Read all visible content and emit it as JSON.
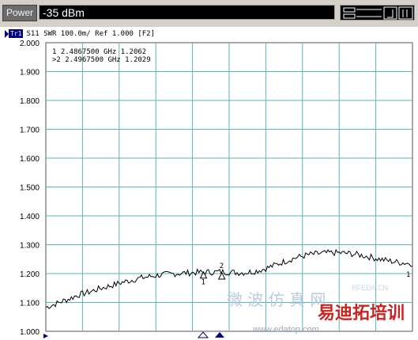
{
  "power": {
    "label": "Power",
    "value": "-35 dBm"
  },
  "trace": {
    "badge": "Tr1",
    "header": "S11  SWR 100.0m/ Ref 1.000 [F2]"
  },
  "markers_table": [
    {
      "id": "1",
      "text": " 1   2.4867500 GHz  1.2062"
    },
    {
      "id": "2",
      "text": ">2   2.4967500 GHz  1.2029"
    }
  ],
  "watermark": {
    "line1": "微 波 仿 真 网",
    "line2": "RFEDA.CN",
    "line3": "易迪拓培训",
    "line4": "www.edatop.com"
  },
  "colors": {
    "grid": "#5fb3b3",
    "frame": "#555555",
    "trace": "#000000",
    "marker_bg": "#000080"
  },
  "chart_data": {
    "type": "line",
    "title": "",
    "ylabel": "",
    "xlabel": "",
    "ylim": [
      1.0,
      2.0
    ],
    "y_ticks": [
      "2.000",
      "1.900",
      "1.800",
      "1.700",
      "1.600",
      "1.500",
      "1.400",
      "1.300",
      "1.200",
      "1.100",
      "1.000"
    ],
    "x_divisions": 10,
    "grid": true,
    "series": [
      {
        "values": [
          1.083,
          1.09,
          1.096,
          1.104,
          1.11,
          1.118,
          1.126,
          1.131,
          1.136,
          1.142,
          1.148,
          1.153,
          1.158,
          1.163,
          1.169,
          1.173,
          1.178,
          1.182,
          1.186,
          1.189,
          1.192,
          1.195,
          1.197,
          1.198,
          1.2,
          1.201,
          1.202,
          1.203,
          1.204,
          1.204,
          1.205,
          1.205,
          1.206,
          1.206,
          1.205,
          1.204,
          1.203,
          1.204,
          1.206,
          1.209,
          1.214,
          1.219,
          1.226,
          1.233,
          1.24,
          1.247,
          1.253,
          1.258,
          1.262,
          1.266,
          1.268,
          1.27,
          1.271,
          1.272,
          1.272,
          1.271,
          1.27,
          1.268,
          1.265,
          1.262,
          1.258,
          1.254,
          1.25,
          1.246,
          1.243,
          1.24,
          1.238,
          1.236,
          1.235
        ]
      }
    ],
    "markers": [
      {
        "id": "1",
        "position_fraction": 0.43,
        "y": 1.2062
      },
      {
        "id": "2",
        "position_fraction": 0.48,
        "y": 1.2029
      }
    ]
  }
}
